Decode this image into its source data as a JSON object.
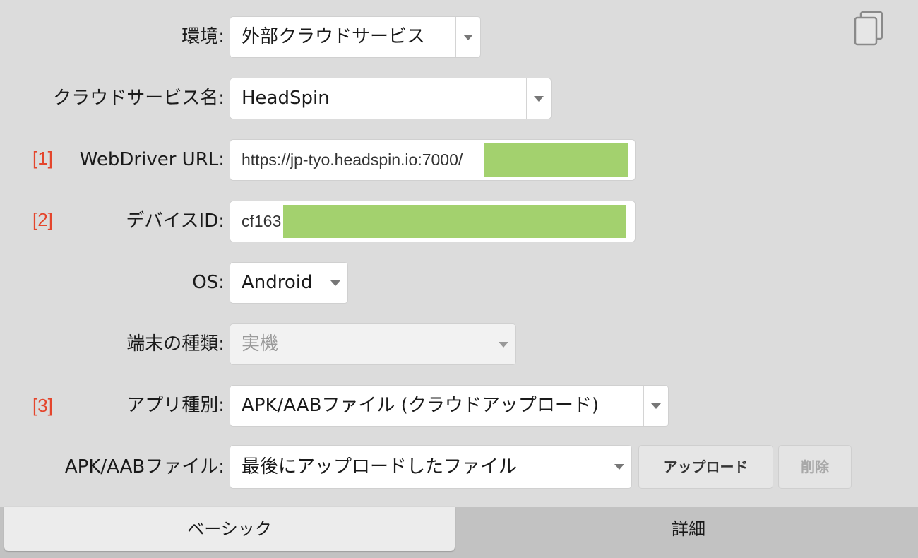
{
  "copy_icon": "copy-icon",
  "fields": {
    "environment": {
      "label": "環境:",
      "value": "外部クラウドサービス"
    },
    "cloud_service": {
      "label": "クラウドサービス名:",
      "value": "HeadSpin"
    },
    "webdriver_url": {
      "marker": "[1]",
      "label": "WebDriver URL:",
      "value": "https://jp-tyo.headspin.io:7000/"
    },
    "device_id": {
      "marker": "[2]",
      "label": "デバイスID:",
      "value": "cf163"
    },
    "os": {
      "label": "OS:",
      "value": "Android"
    },
    "device_type": {
      "label": "端末の種類:",
      "value": "実機"
    },
    "app_type": {
      "marker": "[3]",
      "label": "アプリ種別:",
      "value": "APK/AABファイル (クラウドアップロード)"
    },
    "apk_file": {
      "label": "APK/AABファイル:",
      "value": "最後にアップロードしたファイル"
    }
  },
  "buttons": {
    "upload": "アップロード",
    "delete": "削除"
  },
  "tabs": [
    {
      "label": "ベーシック",
      "active": true
    },
    {
      "label": "詳細",
      "active": false
    }
  ],
  "colors": {
    "marker": "#e4452c",
    "redaction": "#a3d16e",
    "background": "#dcdcdc"
  }
}
